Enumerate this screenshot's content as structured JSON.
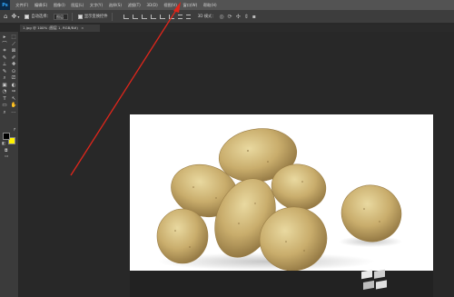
{
  "app": {
    "logo": "Ps",
    "menu": [
      "文件(F)",
      "编辑(E)",
      "图像(I)",
      "图层(L)",
      "文字(Y)",
      "选择(S)",
      "滤镜(T)",
      "3D(D)",
      "视图(V)",
      "窗口(W)",
      "帮助(H)"
    ]
  },
  "options_bar": {
    "move_icon": "move-tool-icon",
    "auto_select_label": "自动选择：",
    "auto_select_value": "图层",
    "transform_label": "显示变换控件",
    "mode_3d_label": "3D 模式："
  },
  "document": {
    "tab_label": "1.jpg @ 100% (图层 1, RGB/8#)",
    "tab_close": "×"
  },
  "colors": {
    "foreground": "#000000",
    "background": "#fff200",
    "annotation_arrow": "#e0261b"
  },
  "toolbar": {
    "tools": [
      "▸",
      "⬚",
      "⌒",
      "⟋",
      "⌗",
      "⊠",
      "✎",
      "✐",
      "⟂",
      "✚",
      "✎",
      "⊙",
      "⌕",
      "⎚",
      "▣",
      "◐",
      "◔",
      "✑",
      "T",
      "↖",
      "▭",
      "✋",
      "⌕",
      "⋯"
    ]
  }
}
